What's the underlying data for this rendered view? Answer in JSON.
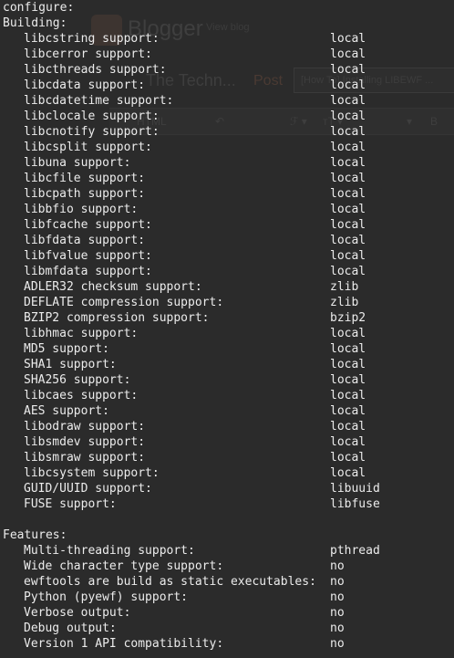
{
  "background_window": {
    "brand": "Blogger",
    "view_blog": "View blog",
    "blog_title": "The Techn...",
    "post_label": "Post",
    "post_title": "[How To] Installing LIBEWF ...",
    "toolbar_html": "HTML",
    "toolbar_items": [
      "↶",
      "ℱ ▾",
      "ᴛT ▾",
      "▾",
      "B"
    ]
  },
  "terminal": {
    "header_line": "configure:",
    "building_header": "Building:",
    "building": [
      {
        "label": "libcstring support:",
        "value": "local"
      },
      {
        "label": "libcerror support:",
        "value": "local"
      },
      {
        "label": "libcthreads support:",
        "value": "local"
      },
      {
        "label": "libcdata support:",
        "value": "local"
      },
      {
        "label": "libcdatetime support:",
        "value": "local"
      },
      {
        "label": "libclocale support:",
        "value": "local"
      },
      {
        "label": "libcnotify support:",
        "value": "local"
      },
      {
        "label": "libcsplit support:",
        "value": "local"
      },
      {
        "label": "libuna support:",
        "value": "local"
      },
      {
        "label": "libcfile support:",
        "value": "local"
      },
      {
        "label": "libcpath support:",
        "value": "local"
      },
      {
        "label": "libbfio support:",
        "value": "local"
      },
      {
        "label": "libfcache support:",
        "value": "local"
      },
      {
        "label": "libfdata support:",
        "value": "local"
      },
      {
        "label": "libfvalue support:",
        "value": "local"
      },
      {
        "label": "libmfdata support:",
        "value": "local"
      },
      {
        "label": "ADLER32 checksum support:",
        "value": "zlib"
      },
      {
        "label": "DEFLATE compression support:",
        "value": "zlib"
      },
      {
        "label": "BZIP2 compression support:",
        "value": "bzip2"
      },
      {
        "label": "libhmac support:",
        "value": "local"
      },
      {
        "label": "MD5 support:",
        "value": "local"
      },
      {
        "label": "SHA1 support:",
        "value": "local"
      },
      {
        "label": "SHA256 support:",
        "value": "local"
      },
      {
        "label": "libcaes support:",
        "value": "local"
      },
      {
        "label": "AES support:",
        "value": "local"
      },
      {
        "label": "libodraw support:",
        "value": "local"
      },
      {
        "label": "libsmdev support:",
        "value": "local"
      },
      {
        "label": "libsmraw support:",
        "value": "local"
      },
      {
        "label": "libcsystem support:",
        "value": "local"
      },
      {
        "label": "GUID/UUID support:",
        "value": "libuuid"
      },
      {
        "label": "FUSE support:",
        "value": "libfuse"
      }
    ],
    "features_header": "Features:",
    "features": [
      {
        "label": "Multi-threading support:",
        "value": "pthread"
      },
      {
        "label": "Wide character type support:",
        "value": "no"
      },
      {
        "label": "ewftools are build as static executables:",
        "value": "no"
      },
      {
        "label": "Python (pyewf) support:",
        "value": "no"
      },
      {
        "label": "Verbose output:",
        "value": "no"
      },
      {
        "label": "Debug output:",
        "value": "no"
      },
      {
        "label": "Version 1 API compatibility:",
        "value": "no"
      }
    ],
    "colors": {
      "background": "#2b2b2b",
      "text": "#ececec"
    }
  }
}
